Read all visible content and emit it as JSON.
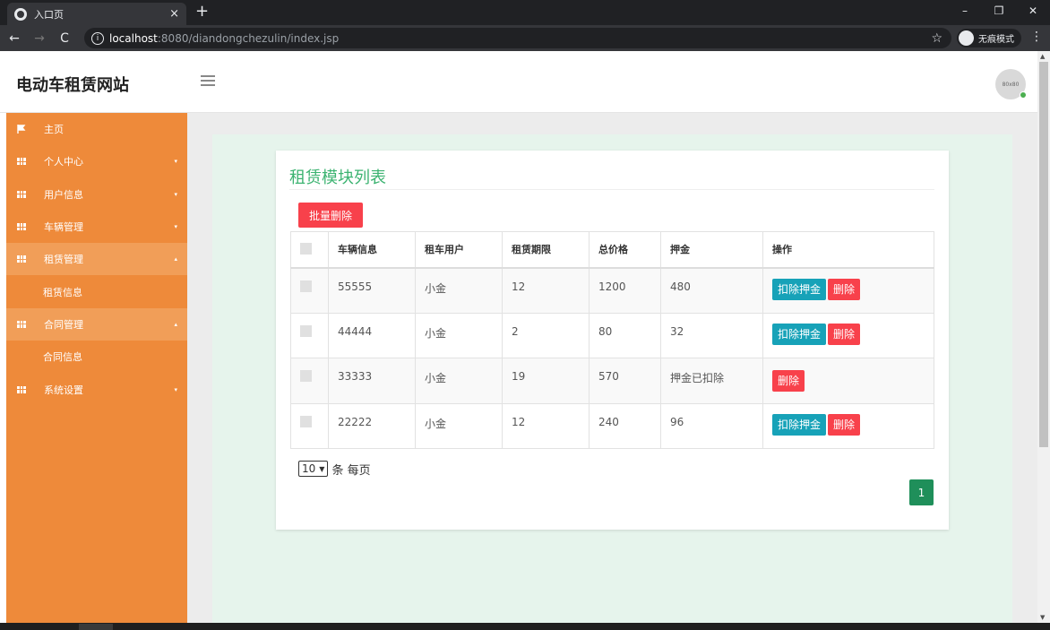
{
  "browser": {
    "tab_title": "入口页",
    "tab_close": "×",
    "new_tab": "+",
    "window_controls": [
      "–",
      "❐",
      "✕"
    ],
    "url_host": "localhost",
    "url_rest": ":8080/diandongchezulin/index.jsp",
    "incognito_label": "无痕模式"
  },
  "header": {
    "brand": "电动车租赁网站",
    "avatar_text": "80x80"
  },
  "sidebar": {
    "items": [
      {
        "label": "主页",
        "icon": "flag-icon"
      },
      {
        "label": "个人中心",
        "icon": "grid-icon",
        "caret": "▾"
      },
      {
        "label": "用户信息",
        "icon": "grid-icon",
        "caret": "▾"
      },
      {
        "label": "车辆管理",
        "icon": "grid-icon",
        "caret": "▾"
      },
      {
        "label": "租赁管理",
        "icon": "grid-icon",
        "caret": "▴",
        "sub": "租赁信息"
      },
      {
        "label": "合同管理",
        "icon": "grid-icon",
        "caret": "▴",
        "sub": "合同信息"
      },
      {
        "label": "系统设置",
        "icon": "grid-icon",
        "caret": "▾"
      }
    ]
  },
  "main": {
    "title": "租赁模块列表",
    "batch_delete": "批量删除",
    "columns": [
      "车辆信息",
      "租车用户",
      "租赁期限",
      "总价格",
      "押金",
      "操作"
    ],
    "rows": [
      {
        "vehicle": "55555",
        "user": "小金",
        "term": "12",
        "total": "1200",
        "deposit": "480",
        "deduct": "扣除押金",
        "delete": "删除"
      },
      {
        "vehicle": "44444",
        "user": "小金",
        "term": "2",
        "total": "80",
        "deposit": "32",
        "deduct": "扣除押金",
        "delete": "删除"
      },
      {
        "vehicle": "33333",
        "user": "小金",
        "term": "19",
        "total": "570",
        "deposit": "押金已扣除",
        "deduct": "",
        "delete": "删除"
      },
      {
        "vehicle": "22222",
        "user": "小金",
        "term": "12",
        "total": "240",
        "deposit": "96",
        "deduct": "扣除押金",
        "delete": "删除"
      }
    ],
    "page_size": "10",
    "page_size_suffix": "条 每页",
    "current_page": "1"
  },
  "colors": {
    "sidebar": "#ee8a3a",
    "title_green": "#3cb371",
    "danger": "#f8414b",
    "info": "#17a2b8",
    "pager": "#1f8f5a"
  }
}
